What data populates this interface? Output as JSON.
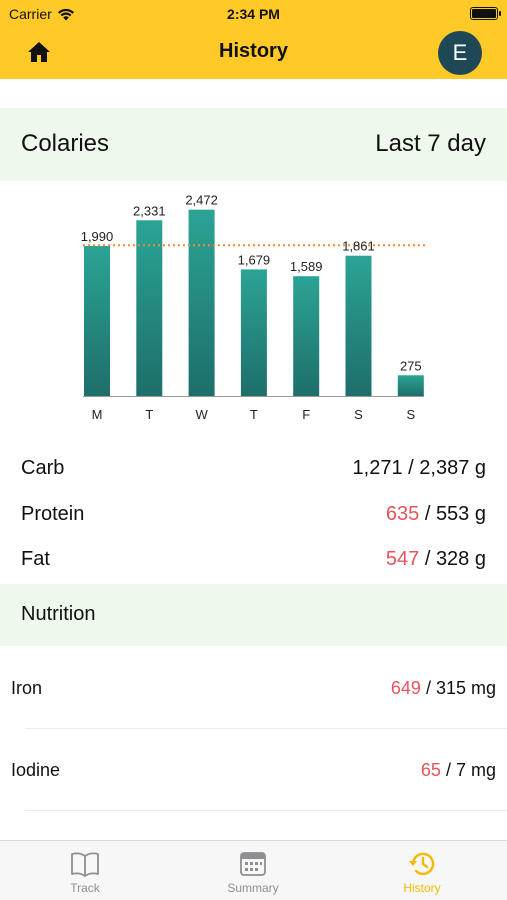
{
  "status_bar": {
    "carrier": "Carrier",
    "time": "2:34 PM"
  },
  "header": {
    "title": "History",
    "avatar_letter": "E"
  },
  "calories_section": {
    "title": "Colaries",
    "range": "Last 7 day"
  },
  "chart_data": {
    "type": "bar",
    "categories": [
      "M",
      "T",
      "W",
      "T",
      "F",
      "S",
      "S"
    ],
    "values": [
      1990,
      2331,
      2472,
      1679,
      1589,
      1861,
      275
    ],
    "value_labels": [
      "1,990",
      "2,331",
      "2,472",
      "1,679",
      "1,589",
      "1,861",
      "275"
    ],
    "target_line": 2000,
    "ylim": [
      0,
      2600
    ],
    "bar_color": "#1E6E6A",
    "bar_color_top": "#2BA495",
    "target_color": "#F28C38"
  },
  "macros": [
    {
      "label": "Carb",
      "consumed": "1,271",
      "separator": " / ",
      "target": "2,387 g",
      "over": false
    },
    {
      "label": "Protein",
      "consumed": "635",
      "separator": " / ",
      "target": "553 g",
      "over": true
    },
    {
      "label": "Fat",
      "consumed": "547",
      "separator": " / ",
      "target": "328 g",
      "over": true
    }
  ],
  "nutrition_section": {
    "title": "Nutrition"
  },
  "nutrition": [
    {
      "label": "Iron",
      "consumed": "649",
      "separator": " / ",
      "target": "315 mg",
      "over": true
    },
    {
      "label": "Iodine",
      "consumed": "65",
      "separator": " / ",
      "target": "7 mg",
      "over": true
    }
  ],
  "tabbar": {
    "tabs": [
      {
        "label": "Track",
        "icon": "book-icon"
      },
      {
        "label": "Summary",
        "icon": "calendar-icon"
      },
      {
        "label": "History",
        "icon": "history-icon",
        "active": true
      }
    ]
  },
  "colors": {
    "header": "#FFC928",
    "band": "#EFF8EC",
    "over": "#E8545E",
    "active_tab": "#F5B800",
    "avatar": "#1F4856"
  }
}
